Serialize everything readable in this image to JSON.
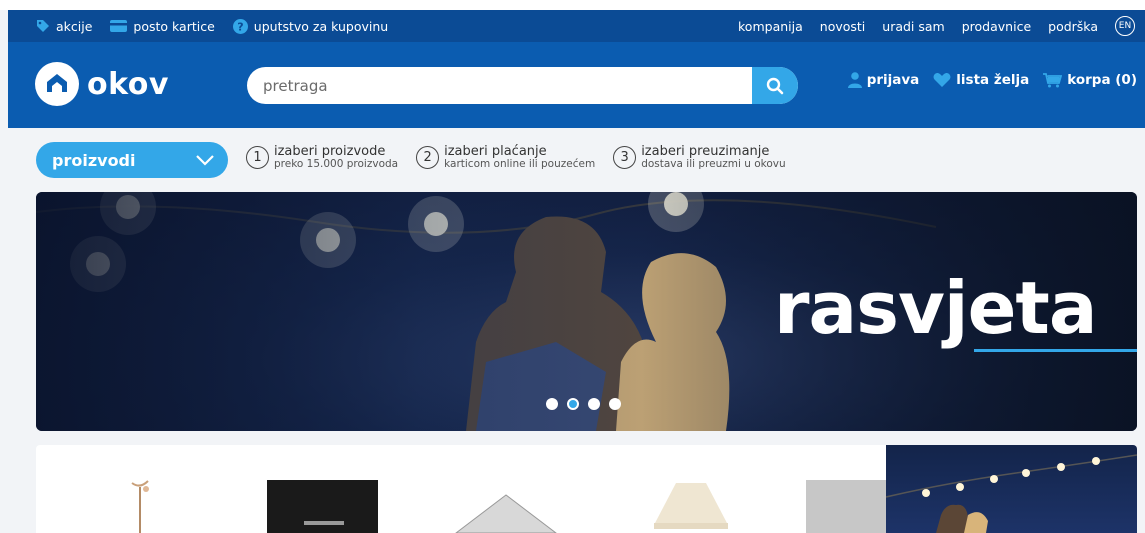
{
  "topnav": {
    "left": [
      {
        "label": "akcije",
        "icon": "tag-icon"
      },
      {
        "label": "posto kartice",
        "icon": "card-icon"
      },
      {
        "label": "uputstvo za kupovinu",
        "icon": "question-icon"
      }
    ],
    "right": [
      "kompanija",
      "novosti",
      "uradi sam",
      "prodavnice",
      "podrška"
    ],
    "lang": "EN"
  },
  "header": {
    "logo_text": "okov",
    "search_placeholder": "pretraga",
    "login": "prijava",
    "wishlist": "lista želja",
    "cart": "korpa (0)"
  },
  "products_menu": {
    "label": "proizvodi"
  },
  "steps": [
    {
      "num": "1",
      "title": "izaberi proizvode",
      "sub": "preko 15.000 proizvoda"
    },
    {
      "num": "2",
      "title": "izaberi plaćanje",
      "sub": "karticom online ili pouzećem"
    },
    {
      "num": "3",
      "title": "izaberi preuzimanje",
      "sub": "dostava ili preuzmi u okovu"
    }
  ],
  "banner": {
    "title": "rasvjeta",
    "slides": 4,
    "active_slide": 2
  },
  "colors": {
    "dark_blue": "#0b4b95",
    "header_blue": "#0b5cb0",
    "accent": "#33a7e8"
  }
}
